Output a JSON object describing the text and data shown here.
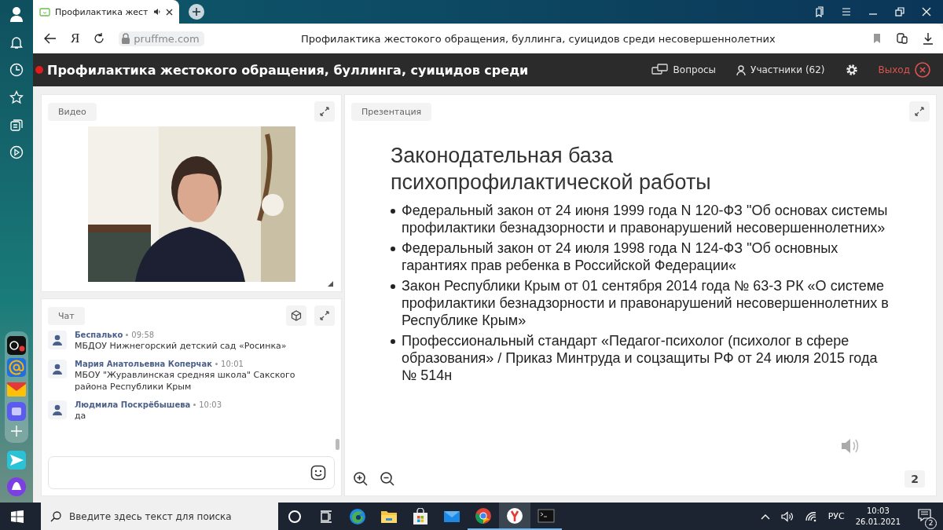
{
  "browser": {
    "tab": {
      "title": "Профилактика жест",
      "selected": true
    },
    "address": {
      "url": "pruffme.com",
      "logo": "Я"
    },
    "page_title": "Профилактика жестокого обращения, буллинга, суицидов среди несовершеннолетних"
  },
  "header": {
    "live": true,
    "title": "Профилактика жестокого обращения, буллинга, суицидов среди",
    "questions": "Вопросы",
    "participants": "Участники (62)",
    "exit": "Выход"
  },
  "video": {
    "label": "Видео",
    "kind": "picture"
  },
  "chat": {
    "label": "Чат",
    "messages": [
      {
        "author": "Беспалько",
        "time": "09:58",
        "text": "МБДОУ Нижнегорский детский сад «Росинка»"
      },
      {
        "author": "Мария Анатольевна Коперчак",
        "time": "10:01",
        "text": "МБОУ \"Журавлинская средняя школа\" Сакского района Республики Крым"
      },
      {
        "author": "Людмила Поскрёбышева",
        "time": "10:03",
        "text": "да"
      }
    ]
  },
  "presentation": {
    "label": "Презентация",
    "slide": {
      "title": "Законодательная база психопрофилактической работы",
      "bullets": [
        "Федеральный закон от 24 июня 1999 года N 120-ФЗ \"Об основах системы профилактики безнадзорности и правонарушений несовершеннолетних»",
        "Федеральный закон от 24 июля 1998 года N 124-ФЗ \"Об основных гарантиях прав ребенка в Российской Федерации«",
        "Закон Республики Крым от 01 сентября 2014 года № 63-З РК «О системе профилактики безнадзорности и правонарушений несовершеннолетних в Республике Крым»",
        "Профессиональный стандарт «Педагог-психолог (психолог в сфере образования» / Приказ Минтруда и соцзащиты РФ от 24 июля 2015 года № 514н"
      ]
    },
    "page": "2"
  },
  "taskbar": {
    "search_placeholder": "Введите здесь текст для поиска",
    "apps": [
      {
        "kind": "cortana",
        "selected": false,
        "running": false
      },
      {
        "kind": "taskview",
        "selected": false,
        "running": false
      },
      {
        "kind": "edge",
        "selected": false,
        "running": false
      },
      {
        "kind": "folder",
        "selected": false,
        "running": false
      },
      {
        "kind": "store",
        "selected": false,
        "running": false
      },
      {
        "kind": "mail",
        "selected": false,
        "running": false
      },
      {
        "kind": "chrome",
        "selected": false,
        "running": true
      },
      {
        "kind": "yandex",
        "selected": true,
        "running": true
      },
      {
        "kind": "terminal",
        "selected": false,
        "running": true
      }
    ],
    "language": "РУС",
    "time": "10:03",
    "date": "26.01.2021",
    "notifications": "2"
  }
}
